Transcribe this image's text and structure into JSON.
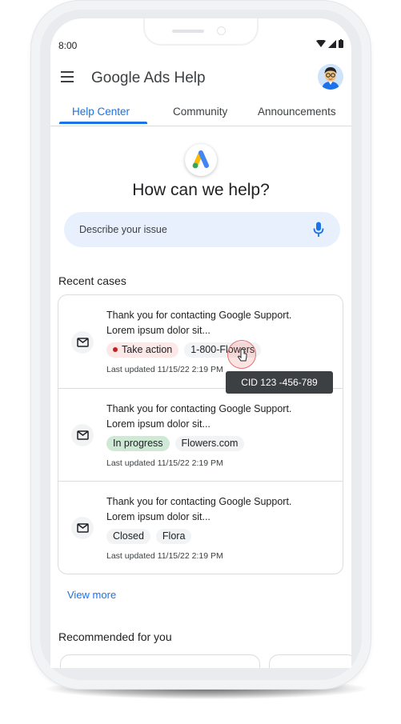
{
  "status_bar": {
    "time": "8:00"
  },
  "app_bar": {
    "title": "Google Ads Help",
    "menu_icon": "hamburger-menu-icon",
    "avatar": "user-avatar"
  },
  "tabs": [
    {
      "label": "Help Center",
      "active": true
    },
    {
      "label": "Community",
      "active": false
    },
    {
      "label": "Announcements",
      "active": false
    }
  ],
  "hero": {
    "logo": "google-ads-logo",
    "title": "How can we help?"
  },
  "search": {
    "placeholder": "Describe your issue",
    "icon": "mic-icon"
  },
  "recent_cases": {
    "title": "Recent cases",
    "items": [
      {
        "line1": "Thank you for contacting Google Support.",
        "line2": "Lorem ipsum dolor sit...",
        "status": "Take action",
        "account": "1-800-Flowers",
        "updated": "Last updated 11/15/22 2:19 PM"
      },
      {
        "line1": "Thank you for contacting Google Support.",
        "line2": "Lorem ipsum dolor sit...",
        "status": "In progress",
        "account": "Flowers.com",
        "updated": "Last updated 11/15/22 2:19 PM"
      },
      {
        "line1": "Thank you for contacting Google Support.",
        "line2": "Lorem ipsum dolor sit...",
        "status": "Closed",
        "account": "Flora",
        "updated": "Last updated 11/15/22 2:19 PM"
      }
    ],
    "tooltip": "CID 123 -456-789",
    "view_more": "View more"
  },
  "recommended": {
    "title": "Recommended for you"
  },
  "colors": {
    "accent": "#1a73e8",
    "take_action_bg": "#fce8e6",
    "in_progress_bg": "#ceead6",
    "status_dot": "#c5221f"
  }
}
